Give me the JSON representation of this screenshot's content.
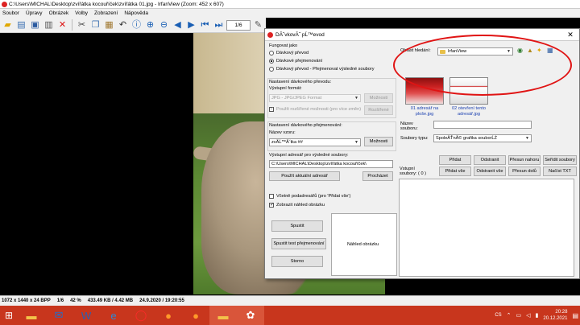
{
  "window": {
    "title": "C:\\Users\\MICHAL\\Desktop\\zvířátka kocouříček\\zvířátka 01.jpg - IrfanView (Zoom: 452 x 607)"
  },
  "menu": [
    "Soubor",
    "Úpravy",
    "Obrázek",
    "Volby",
    "Zobrazení",
    "Nápověda"
  ],
  "toolbar": {
    "page_indicator": "1/6"
  },
  "statusbar": [
    "1072 x 1440 x 24 BPP",
    "1/6",
    "42 %",
    "433.49 KB / 4.42 MB",
    "24.9.2020 / 19:20:55"
  ],
  "taskbar": {
    "lang": "CS",
    "time": "20:28",
    "date": "20.12.2021",
    "apps": [
      "explorer",
      "outlook",
      "word",
      "edge",
      "opera",
      "firefox",
      "firefox",
      "folder",
      "irfanview"
    ]
  },
  "dialog": {
    "title": "DĂˇvkovĂ˝ pĹ™evod",
    "function_group": "Fungovat jako",
    "modes": [
      "Dávkový převod",
      "Dávkové přejmenování",
      "Dávkový převod - Přejmenovat výsledné soubory"
    ],
    "selected_mode": 1,
    "conversion_group": "Nastavení dávkového převodu:",
    "output_format_label": "Výstupní formát:",
    "output_format_value": "JPG - JPG/JPEG Format",
    "options_button": "Možnosti",
    "advanced_checkbox": "Použít rozšířené možnosti (pro více změn)",
    "advanced_button": "Rozšířené",
    "rename_group": "Nastavení dávkového přejmenování:",
    "pattern_label": "Název vzoru:",
    "pattern_value": "zvĂ­Ĺ™Ăˇtka ##",
    "pattern_options_button": "Možnosti",
    "outdir_label": "Výstupní adresář pro výsledné soubory:",
    "outdir_value": "C:\\Users\\MICHAL\\Desktop\\zvířátka kocouříček\\",
    "use_current_button": "Použít aktuální adresář",
    "browse_button": "Procházet",
    "include_subdirs": "Včetně podadresářů (pro 'Přidat vše')",
    "show_preview": "Zobrazit náhled obrázku",
    "start_button": "Spustit",
    "test_rename_button": "Spustit test přejmenování",
    "cancel_button": "Storno",
    "preview_label": "Náhled obrázku",
    "search_area_label": "Oblast hledání:",
    "search_area_value": "IrfanView",
    "thumbs": [
      {
        "caption1": "01 adresář na",
        "caption2": "ploše.jpg"
      },
      {
        "caption1": "02 otevření tento",
        "caption2": "adresář.jpg"
      }
    ],
    "filename_label1": "Název",
    "filename_label2": "souboru:",
    "filename_value": "",
    "filetype_label": "Soubory typu:",
    "filetype_value": "SpoleÄŤnĂ© grafika souborĹŻ",
    "add_button": "Přidat",
    "remove_button": "Odstranit",
    "move_up_button": "Přesun nahoru",
    "sort_button": "Seřídit soubory",
    "add_all_button": "Přidat vše",
    "remove_all_button": "Odstranit vše",
    "move_down_button": "Přesun dolů",
    "load_txt_button": "Načíst TXT",
    "input_files_label1": "Vstupní",
    "input_files_label2": "soubory:",
    "input_files_count": "( 0 )"
  }
}
